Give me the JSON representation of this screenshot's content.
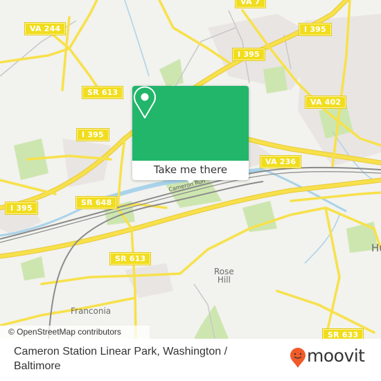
{
  "map": {
    "road_shields": [
      {
        "label": "VA 244"
      },
      {
        "label": "VA 7"
      },
      {
        "label": "I 395"
      },
      {
        "label": "I 395"
      },
      {
        "label": "SR 613"
      },
      {
        "label": "VA 402"
      },
      {
        "label": "I 395"
      },
      {
        "label": "VA 236"
      },
      {
        "label": "I 395"
      },
      {
        "label": "SR 648"
      },
      {
        "label": "SR 613"
      },
      {
        "label": "SR 633"
      }
    ],
    "places": [
      {
        "label": "Rose\nHill",
        "line1": "Rose",
        "line2": "Hill"
      },
      {
        "label": "Franconia"
      },
      {
        "label": "Hu"
      }
    ],
    "waterway_label": "Cameron Run",
    "attribution": "© OpenStreetMap contributors"
  },
  "popup": {
    "icon": "map-pin-icon",
    "button_label": "Take me there",
    "accent_color": "#21b66a"
  },
  "footer": {
    "title": "Cameron Station Linear Park, Washington / Baltimore",
    "brand": "moovit",
    "brand_color": "#f15a29"
  }
}
